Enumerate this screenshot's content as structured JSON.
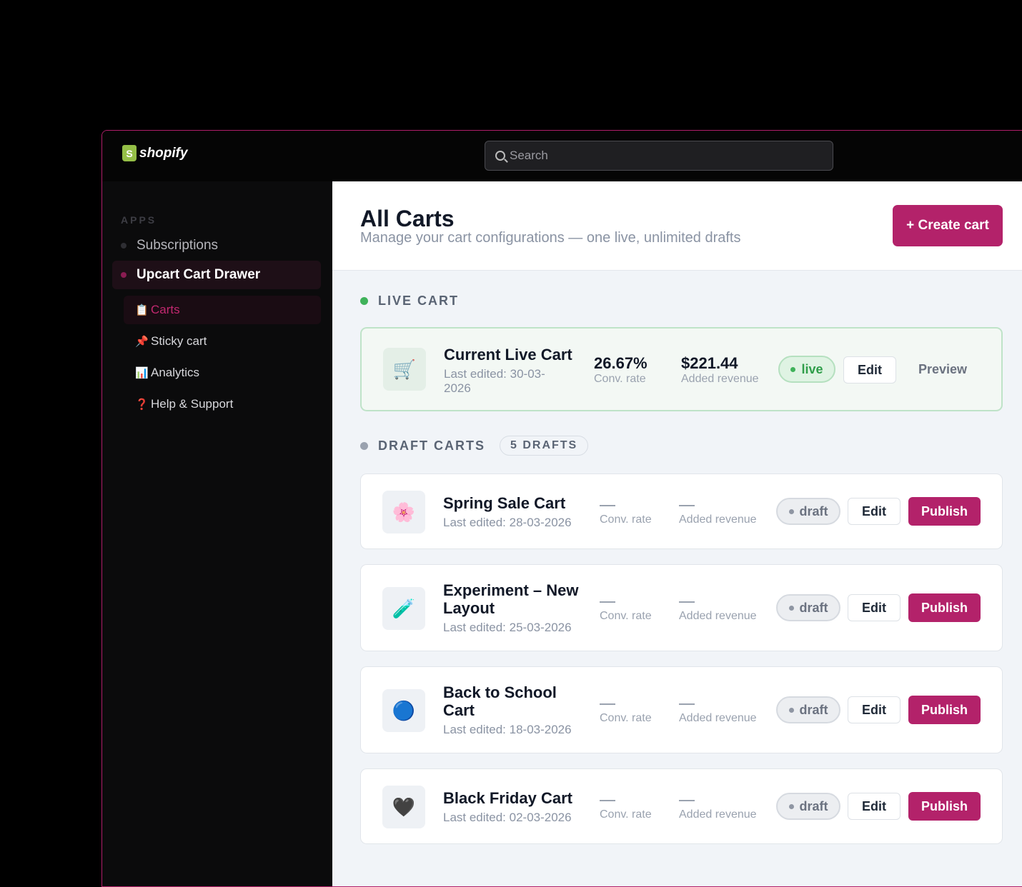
{
  "topbar": {
    "brand": "shopify",
    "search_placeholder": "Search"
  },
  "sidebar": {
    "section_label": "APPS",
    "apps": [
      {
        "label": "Subscriptions"
      },
      {
        "label": "Upcart Cart Drawer"
      }
    ],
    "sub_items": [
      {
        "icon": "📋",
        "label": "Carts"
      },
      {
        "icon": "📌",
        "label": "Sticky cart"
      },
      {
        "icon": "📊",
        "label": "Analytics"
      },
      {
        "icon": "❓",
        "label": "Help & Support"
      }
    ]
  },
  "header": {
    "title": "All Carts",
    "subtitle": "Manage your cart configurations — one live, unlimited drafts",
    "create_label": "+ Create cart"
  },
  "live_section": {
    "label": "LIVE CART",
    "card": {
      "icon": "🛒",
      "name": "Current Live Cart",
      "last_edited": "Last edited: 30-03-2026",
      "conv_rate": "26.67%",
      "conv_label": "Conv. rate",
      "revenue": "$221.44",
      "revenue_label": "Added revenue",
      "status": "live",
      "edit_label": "Edit",
      "preview_label": "Preview"
    }
  },
  "draft_section": {
    "label": "DRAFT CARTS",
    "count": "5 DRAFTS",
    "conv_label": "Conv. rate",
    "revenue_label": "Added revenue",
    "status": "draft",
    "edit_label": "Edit",
    "publish_label": "Publish",
    "cards": [
      {
        "icon": "🌸",
        "name": "Spring Sale Cart",
        "last_edited": "Last edited: 28-03-2026"
      },
      {
        "icon": "🧪",
        "name": "Experiment – New Layout",
        "last_edited": "Last edited: 25-03-2026"
      },
      {
        "icon": "🔵",
        "name": "Back to School Cart",
        "last_edited": "Last edited: 18-03-2026"
      },
      {
        "icon": "🖤",
        "name": "Black Friday Cart",
        "last_edited": "Last edited: 02-03-2026"
      }
    ]
  },
  "colors": {
    "accent": "#b3226a",
    "live": "#3fb25a"
  }
}
